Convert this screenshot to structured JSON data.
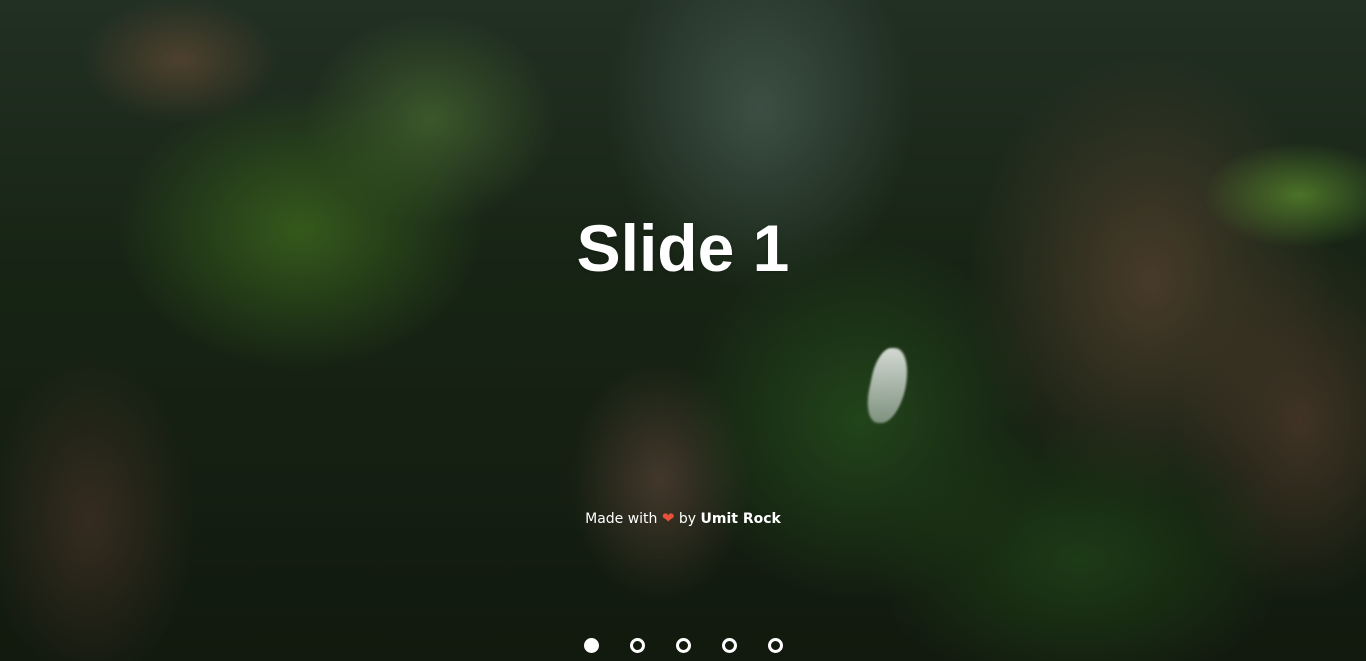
{
  "slide": {
    "title": "Slide 1",
    "background": "canyon landscape photo"
  },
  "credit": {
    "prefix": "Made with",
    "heart": "❤",
    "middle": "by",
    "author": "Umit Rock"
  },
  "pagination": {
    "total": 5,
    "active_index": 0,
    "dots": [
      "dot-1",
      "dot-2",
      "dot-3",
      "dot-4",
      "dot-5"
    ]
  },
  "colors": {
    "text": "#ffffff",
    "heart": "#e8503a"
  }
}
